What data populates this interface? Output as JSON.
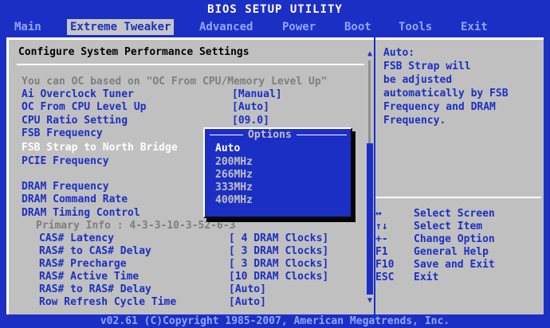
{
  "title": "BIOS SETUP UTILITY",
  "menu": {
    "items": [
      {
        "label": "Main",
        "active": false
      },
      {
        "label": "Extreme Tweaker",
        "active": true
      },
      {
        "label": "Advanced",
        "active": false
      },
      {
        "label": "Power",
        "active": false
      },
      {
        "label": "Boot",
        "active": false
      },
      {
        "label": "Tools",
        "active": false
      },
      {
        "label": "Exit",
        "active": false
      }
    ]
  },
  "main": {
    "heading": "Configure System Performance Settings",
    "note": "You can OC based on \"OC From CPU/Memory Level Up\"",
    "settings": [
      {
        "label": "Ai Overclock Tuner",
        "value": "[Manual]"
      },
      {
        "label": "OC From CPU Level Up",
        "value": "[Auto]"
      },
      {
        "label": "CPU Ratio Setting",
        "value": "[09.0]"
      },
      {
        "label": "FSB Frequency",
        "value": ""
      },
      {
        "label": "FSB Strap to North Bridge",
        "value": ""
      },
      {
        "label": "PCIE Frequency",
        "value": ""
      },
      {
        "label": "DRAM Frequency",
        "value": ""
      },
      {
        "label": "DRAM Command Rate",
        "value": ""
      },
      {
        "label": "DRAM Timing Control",
        "value": ""
      }
    ],
    "primary_info": "Primary Info : 4-3-3-10-3-52-6-3",
    "timings": [
      {
        "label": "CAS# Latency",
        "value": "[ 4 DRAM Clocks]"
      },
      {
        "label": "RAS# to CAS# Delay",
        "value": "[ 3 DRAM Clocks]"
      },
      {
        "label": "RAS# Precharge",
        "value": "[ 3 DRAM Clocks]"
      },
      {
        "label": "RAS# Active Time",
        "value": "[10 DRAM Clocks]"
      },
      {
        "label": "RAS# to RAS# Delay",
        "value": "[Auto]"
      },
      {
        "label": "Row Refresh Cycle Time",
        "value": "[Auto]"
      }
    ],
    "scroll_up_icon": "triangle-up",
    "scroll_down_icon": "triangle-down"
  },
  "options_popup": {
    "title": "Options",
    "items": [
      "Auto",
      "200MHz",
      "266MHz",
      "333MHz",
      "400MHz"
    ],
    "selected": "Auto"
  },
  "help": {
    "text": [
      "Auto:",
      "FSB Strap will",
      "be adjusted",
      "automatically by FSB",
      "Frequency and DRAM",
      "Frequency."
    ],
    "keys": [
      {
        "key": "↔",
        "desc": "Select Screen"
      },
      {
        "key": "↑↓",
        "desc": "Select Item"
      },
      {
        "key": "+-",
        "desc": "Change Option"
      },
      {
        "key": "F1",
        "desc": "General Help"
      },
      {
        "key": "F10",
        "desc": "Save and Exit"
      },
      {
        "key": "ESC",
        "desc": "Exit"
      }
    ]
  },
  "footer": "v02.61 (C)Copyright 1985-2007, American Megatrends, Inc.",
  "colors": {
    "background": "#1c2fc4",
    "panel": "#c0c0c0",
    "highlight": "#ffffff"
  }
}
